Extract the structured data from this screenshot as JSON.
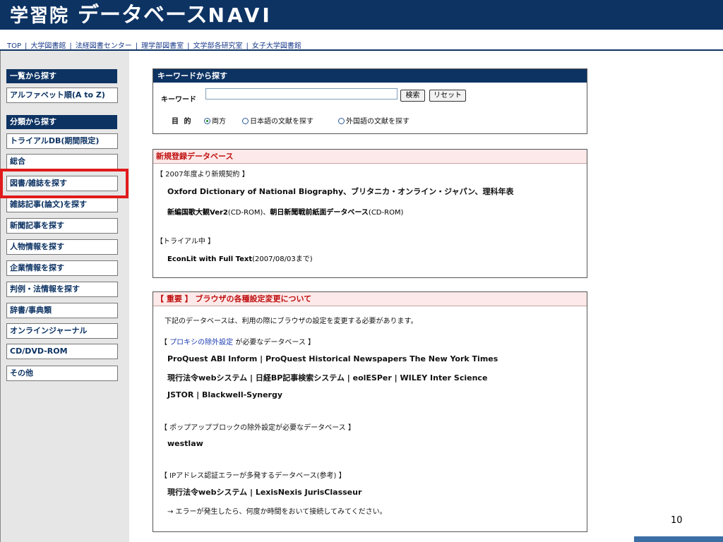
{
  "header": {
    "logo_part1": "学習院",
    "logo_part2": "データベース",
    "logo_part3": "NAVI"
  },
  "navbar": {
    "links": [
      "TOP",
      "大学図書館",
      "法経図書センター",
      "理学部図書室",
      "文学部各研究室",
      "女子大学図書館"
    ],
    "separator": "|"
  },
  "sidebar": {
    "head1": "一覧から探す",
    "alphabet": "アルファベット順(A to Z)",
    "head2": "分類から探す",
    "items": [
      "トライアルDB(期間限定)",
      "総合",
      "図書/雑誌を探す",
      "雑誌記事(論文)を探す",
      "新聞記事を探す",
      "人物情報を探す",
      "企業情報を探す",
      "判例・法情報を探す",
      "辞書/事典類",
      "オンラインジャーナル",
      "CD/DVD-ROM",
      "その他"
    ]
  },
  "keyword": {
    "title": "キーワードから探す",
    "label": "キーワード",
    "value": "",
    "search_btn": "検索",
    "reset_btn": "リセット",
    "purpose_label": "目 的",
    "options": [
      "両方",
      "日本語の文献を探す",
      "外国語の文献を探す"
    ],
    "selected": "両方"
  },
  "new_db": {
    "title": "新規登録データベース",
    "section1": "【 2007年度より新規契約 】",
    "line1": "Oxford Dictionary of National Biography、ブリタニカ・オンライン・ジャパン、理科年表",
    "line2_bold": "新編国歌大観Ver2",
    "line2_rest": "(CD-ROM)、",
    "line2_bold2": "朝日新聞戦前紙面データベース",
    "line2_rest2": "(CD-ROM)",
    "section2": "【トライアル中 】",
    "line3_bold": "EconLit with Full Text",
    "line3_rest": "(2007/08/03まで)"
  },
  "important": {
    "title": "【 重要 】 ブラウザの各種設定変更について",
    "intro": "下記のデータベースは、利用の際にブラウザの設定を変更する必要があります。",
    "proxy_open": "【 ",
    "proxy_link": "プロキシの除外設定",
    "proxy_rest": " が必要なデータベース 】",
    "proxy_line1": "ProQuest ABI Inform | ProQuest Historical Newspapers The New York Times",
    "proxy_line2": "現行法令webシステム | 日経BP記事検索システム | eolESPer | WILEY Inter Science",
    "proxy_line3": "JSTOR | Blackwell-Synergy",
    "popup_head": "【 ポップアップブロックの除外設定が必要なデータベース 】",
    "popup_line": "westlaw",
    "ip_head": "【 IPアドレス認証エラーが多発するデータベース(参考) 】",
    "ip_line": "現行法令webシステム | LexisNexis JurisClasseur",
    "ip_note": "→ エラーが発生したら、何度か時間をおいて接続してみてください。"
  },
  "page_number": "10"
}
